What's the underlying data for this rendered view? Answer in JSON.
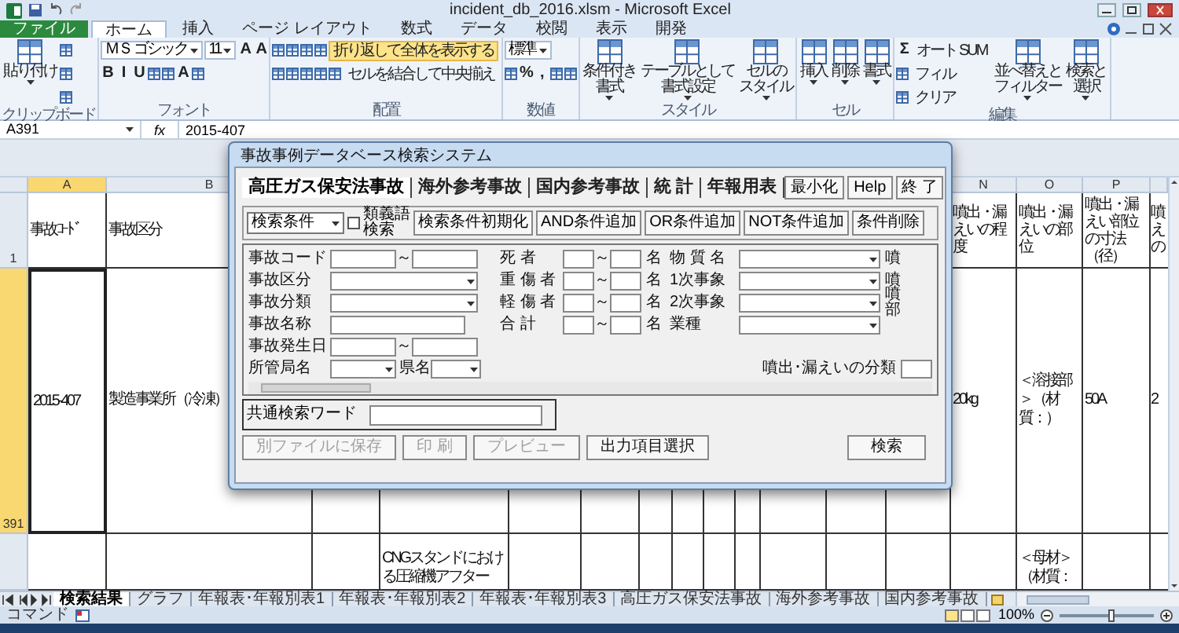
{
  "window": {
    "title": "incident_db_2016.xlsm - Microsoft Excel"
  },
  "ribbon_tabs": [
    {
      "label": "ファイル",
      "kind": "file",
      "selected": false
    },
    {
      "label": "ホーム",
      "kind": "tab",
      "selected": true
    },
    {
      "label": "挿入",
      "kind": "tab",
      "selected": false
    },
    {
      "label": "ページ レイアウト",
      "kind": "tab",
      "selected": false
    },
    {
      "label": "数式",
      "kind": "tab",
      "selected": false
    },
    {
      "label": "データ",
      "kind": "tab",
      "selected": false
    },
    {
      "label": "校閲",
      "kind": "tab",
      "selected": false
    },
    {
      "label": "表示",
      "kind": "tab",
      "selected": false
    },
    {
      "label": "開発",
      "kind": "tab",
      "selected": false
    }
  ],
  "ribbon_groups": [
    {
      "label": "クリップボード",
      "parts": [
        {
          "kind": "large",
          "lines": [
            "貼り付け"
          ]
        },
        {
          "kind": "stack",
          "bands": [
            {
              "items": [
                {
                  "kind": "icon"
                }
              ]
            },
            {
              "items": [
                {
                  "kind": "icon"
                }
              ]
            },
            {
              "items": [
                {
                  "kind": "icon"
                }
              ]
            }
          ]
        }
      ]
    },
    {
      "label": "フォント",
      "parts": [
        {
          "kind": "stack",
          "bands": [
            {
              "items": [
                {
                  "kind": "select",
                  "value": "ＭＳ ゴシック"
                },
                {
                  "kind": "select",
                  "value": "11"
                },
                {
                  "kind": "glyph",
                  "text": "A"
                },
                {
                  "kind": "glyph",
                  "text": "A"
                }
              ]
            },
            {
              "items": [
                {
                  "kind": "glyph",
                  "text": "B"
                },
                {
                  "kind": "glyph",
                  "text": "I"
                },
                {
                  "kind": "glyph",
                  "text": "U"
                },
                {
                  "kind": "icon"
                },
                {
                  "kind": "icon"
                },
                {
                  "kind": "glyph",
                  "text": "A"
                },
                {
                  "kind": "icon"
                }
              ]
            }
          ]
        }
      ]
    },
    {
      "label": "配置",
      "parts": [
        {
          "kind": "stack",
          "bands": [
            {
              "items": [
                {
                  "kind": "icon"
                },
                {
                  "kind": "icon"
                },
                {
                  "kind": "icon"
                },
                {
                  "kind": "icon"
                },
                {
                  "kind": "command",
                  "label": "折り返して全体を表示する",
                  "on": true
                }
              ]
            },
            {
              "items": [
                {
                  "kind": "icon"
                },
                {
                  "kind": "icon"
                },
                {
                  "kind": "icon"
                },
                {
                  "kind": "icon"
                },
                {
                  "kind": "icon"
                },
                {
                  "kind": "command",
                  "label": "セルを結合して中央揃え",
                  "on": false
                }
              ]
            }
          ]
        }
      ]
    },
    {
      "label": "数値",
      "parts": [
        {
          "kind": "stack",
          "bands": [
            {
              "items": [
                {
                  "kind": "select",
                  "value": "標準"
                }
              ]
            },
            {
              "items": [
                {
                  "kind": "icon"
                },
                {
                  "kind": "glyph",
                  "text": "%"
                },
                {
                  "kind": "glyph",
                  "text": ","
                },
                {
                  "kind": "icon"
                },
                {
                  "kind": "icon"
                }
              ]
            }
          ]
        }
      ]
    },
    {
      "label": "スタイル",
      "parts": [
        {
          "kind": "large",
          "lines": [
            "条件付き",
            "書式"
          ]
        },
        {
          "kind": "large",
          "lines": [
            "テーブルとして",
            "書式設定"
          ]
        },
        {
          "kind": "large",
          "lines": [
            "セルの",
            "スタイル"
          ]
        }
      ]
    },
    {
      "label": "セル",
      "parts": [
        {
          "kind": "large",
          "lines": [
            "挿入"
          ]
        },
        {
          "kind": "large",
          "lines": [
            "削除"
          ]
        },
        {
          "kind": "large",
          "lines": [
            "書式"
          ]
        }
      ]
    },
    {
      "label": "編集",
      "parts": [
        {
          "kind": "stack",
          "bands": [
            {
              "items": [
                {
                  "kind": "glyph",
                  "text": "Σ"
                },
                {
                  "kind": "command",
                  "label": "オート SUM",
                  "on": false
                }
              ]
            },
            {
              "items": [
                {
                  "kind": "icon"
                },
                {
                  "kind": "command",
                  "label": "フィル",
                  "on": false
                }
              ]
            },
            {
              "items": [
                {
                  "kind": "icon"
                },
                {
                  "kind": "command",
                  "label": "クリア",
                  "on": false
                }
              ]
            }
          ]
        },
        {
          "kind": "large",
          "lines": [
            "並べ替えと",
            "フィルター"
          ]
        },
        {
          "kind": "large",
          "lines": [
            "検索と",
            "選択"
          ]
        }
      ]
    }
  ],
  "formula_bar": {
    "name_box": "A391",
    "function_label": "fx",
    "formula": "2015-407"
  },
  "columns": [
    {
      "label": "A",
      "selected": true
    },
    {
      "label": "B",
      "selected": false
    },
    {},
    {},
    {},
    {},
    {},
    {},
    {},
    {},
    {},
    {},
    {},
    {
      "label": "N",
      "selected": false
    },
    {
      "label": "O",
      "selected": false
    },
    {
      "label": "P",
      "selected": false
    },
    {}
  ],
  "rows": [
    {
      "number": "1",
      "selected": false,
      "cells": [
        "事故ｺｰﾄﾞ",
        "事故区分",
        null,
        null,
        null,
        null,
        null,
        null,
        null,
        null,
        null,
        null,
        null,
        "噴出・漏えいの程度",
        "噴出・漏えいの部位",
        "噴出・漏えい部位の寸法（径）",
        "噴えの"
      ]
    },
    {
      "number": "391",
      "selected": true,
      "cells": [
        "2015-407",
        "製造事業所（冷凍）",
        null,
        null,
        null,
        null,
        null,
        null,
        null,
        null,
        null,
        null,
        null,
        "20kg",
        "＜溶接部＞（材質：）",
        "50A",
        "2"
      ]
    },
    {
      "selected": false,
      "cells": [
        null,
        null,
        null,
        "CNGスタンドにおける圧縮機アフター",
        null,
        null,
        null,
        null,
        null,
        null,
        null,
        null,
        null,
        null,
        "＜母材＞（材質：",
        null,
        null
      ]
    }
  ],
  "sheet_tabs": [
    {
      "label": "検索結果",
      "selected": true
    },
    {
      "label": "グラフ",
      "selected": false
    },
    {
      "label": "年報表･年報別表1",
      "selected": false
    },
    {
      "label": "年報表･年報別表2",
      "selected": false
    },
    {
      "label": "年報表･年報別表3",
      "selected": false
    },
    {
      "label": "高圧ガス保安法事故",
      "selected": false
    },
    {
      "label": "海外参考事故",
      "selected": false
    },
    {
      "label": "国内参考事故",
      "selected": false
    }
  ],
  "status_bar": {
    "mode": "コマンド",
    "zoom": "100%",
    "zoom_slider": {
      "level": 0.55
    }
  },
  "dialog": {
    "title": "事故事例データベース検索システム",
    "tabs": [
      {
        "label": "高圧ガス保安法事故",
        "selected": true
      },
      {
        "label": "海外参考事故",
        "selected": false
      },
      {
        "label": "国内参考事故",
        "selected": false
      },
      {
        "label": "統 計",
        "selected": false
      },
      {
        "label": "年報用表",
        "selected": false
      }
    ],
    "window_buttons": [
      {
        "label": "最小化"
      },
      {
        "label": "Help"
      },
      {
        "label": "終 了"
      }
    ],
    "condition_select": {
      "value": "検索条件"
    },
    "synonym_checkbox": {
      "label": "類義語検索",
      "checked": false
    },
    "toolbar_buttons": [
      {
        "label": "検索条件初期化"
      },
      {
        "label": "AND条件追加"
      },
      {
        "label": "OR条件追加"
      },
      {
        "label": "NOT条件追加"
      },
      {
        "label": "条件削除"
      }
    ],
    "form_rows": [
      {
        "left": {
          "label": "事故コード",
          "kind": "range",
          "separator": "～"
        },
        "middle": {
          "label": "死 者",
          "separator": "～",
          "unit": "名"
        },
        "right": {
          "label": "物 質 名",
          "kind": "dropdown"
        },
        "edge_label": "噴"
      },
      {
        "left": {
          "label": "事故区分",
          "kind": "dropdown"
        },
        "middle": {
          "label": "重 傷 者",
          "separator": "～",
          "unit": "名"
        },
        "right": {
          "label": "1次事象",
          "kind": "dropdown"
        },
        "edge_label": "噴"
      },
      {
        "left": {
          "label": "事故分類",
          "kind": "dropdown"
        },
        "middle": {
          "label": "軽 傷 者",
          "separator": "～",
          "unit": "名"
        },
        "right": {
          "label": "2次事象",
          "kind": "dropdown"
        },
        "edge_label": "噴部"
      },
      {
        "left": {
          "label": "事故名称",
          "kind": "text"
        },
        "middle": {
          "label": "合 計",
          "separator": "～",
          "unit": "名"
        },
        "right": {
          "label": "業種",
          "kind": "dropdown"
        }
      },
      {
        "left": {
          "label": "事故発生日",
          "kind": "range",
          "separator": "～"
        }
      },
      {
        "left": {
          "label": "所管局名",
          "kind": "dropdown_pair",
          "second_label": "県名"
        },
        "right": {
          "label": "噴出･漏えいの分類",
          "kind": "edge_text"
        }
      }
    ],
    "common_keyword": {
      "label": "共通検索ワード"
    },
    "bottom_buttons": [
      {
        "label": "別ファイルに保存",
        "disabled": true
      },
      {
        "label": "印 刷",
        "disabled": true
      },
      {
        "label": "プレビュー",
        "disabled": true
      },
      {
        "label": "出力項目選択",
        "disabled": false
      },
      {
        "label": "検索",
        "disabled": false
      }
    ]
  }
}
